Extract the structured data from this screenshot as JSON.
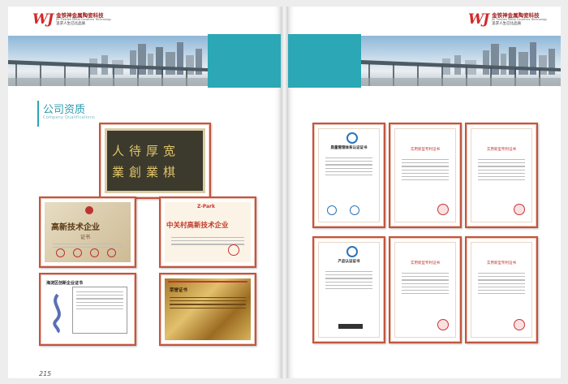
{
  "header": {
    "logo_mark": "WJ",
    "company_cn": "金铁神金属陶瓷科技",
    "company_en": "Jin Tieshen Metal Ceramics Technology",
    "slogan": "追求人生已比品质"
  },
  "section": {
    "title": "公司资质",
    "subtitle": "Company Qualifications"
  },
  "calligraphy": {
    "line1": "人待厚宽",
    "line2": "業創業棋"
  },
  "certificates": {
    "high_tech": {
      "title": "高新技术企业",
      "sub": "证书"
    },
    "zhongguancun": {
      "brand": "Z-Park",
      "title": "中关村高新技术企业"
    },
    "haidian": {
      "title": "海淀区创新企业证书"
    },
    "plaque_heading": "荣誉证书",
    "quality": {
      "title": "质量管理体系认证证书"
    },
    "product": {
      "title": "产品认证证书"
    },
    "patent": {
      "title": "实用新型专利证书"
    }
  },
  "colors": {
    "accent_teal": "#2ba7b5",
    "frame_red": "#c2553f",
    "gold": "#c9a24a"
  },
  "footer": {
    "page_number": "215"
  }
}
